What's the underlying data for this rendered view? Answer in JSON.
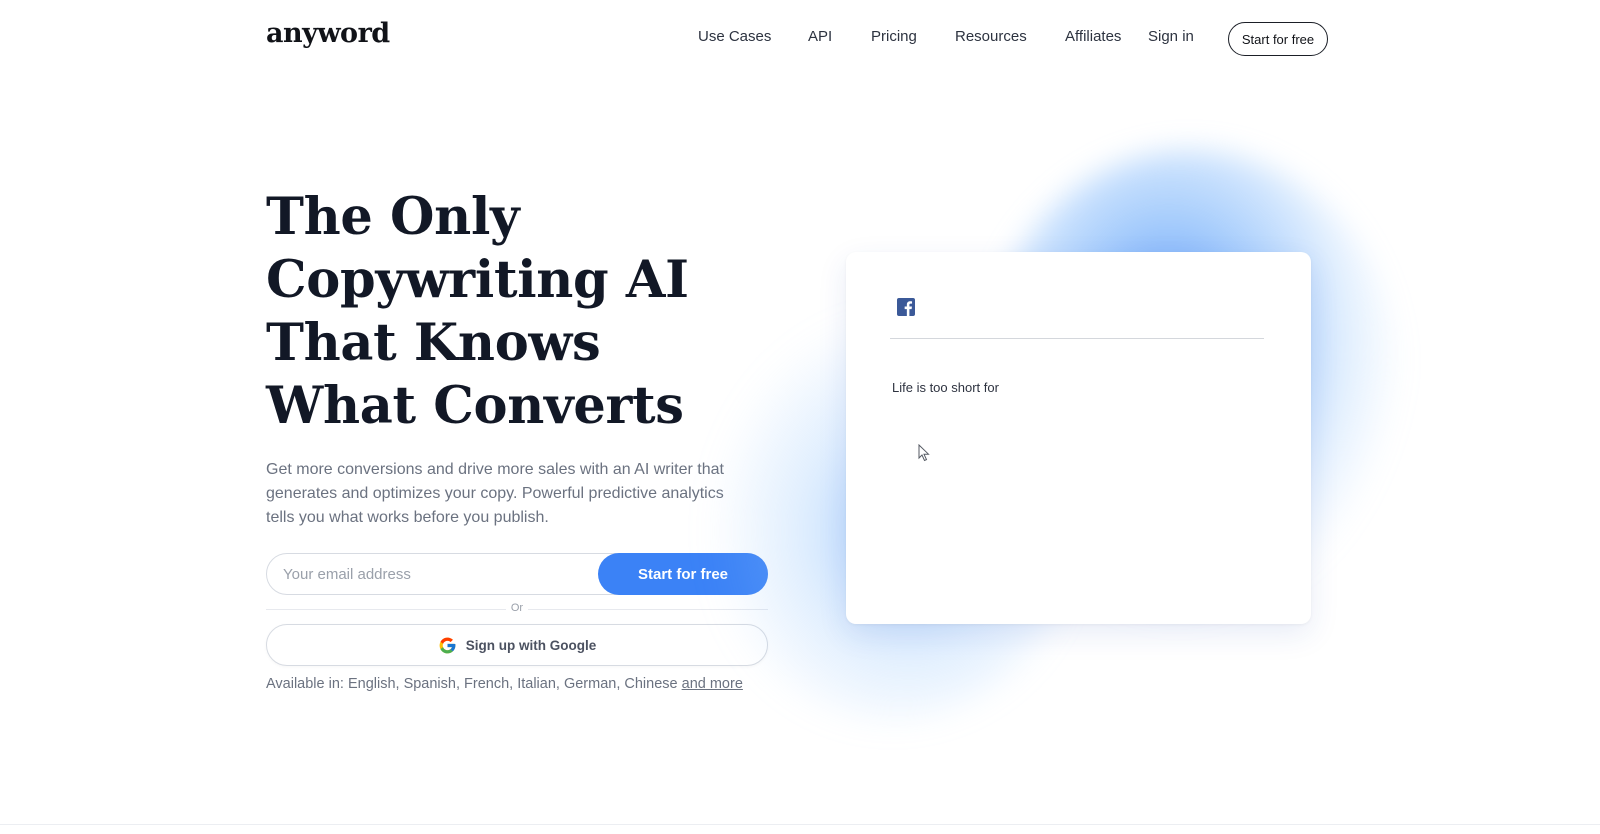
{
  "header": {
    "logo": "anyword",
    "nav": [
      "Use Cases",
      "API",
      "Pricing",
      "Resources",
      "Affiliates",
      "Sign in"
    ],
    "cta": "Start for free"
  },
  "hero": {
    "title": "The Only Copywriting AI That Knows What Converts",
    "subtitle": "Get more conversions and drive more sales with an AI writer that generates and optimizes your copy. Powerful predictive analytics tells you what works before you publish.",
    "email_placeholder": "Your email address",
    "submit_label": "Start for free",
    "or": "Or",
    "google_label": "Sign up with Google",
    "langs_prefix": "Available in: English, Spanish, French, Italian, German, Chinese",
    "langs_more": "and more"
  },
  "card": {
    "platform_icon": "facebook-icon",
    "typed_text": "Life is too short for",
    "brand_color": "#3b5998"
  },
  "colors": {
    "accent": "#3b82f6",
    "text_dark": "#121826",
    "text_muted": "#6b7280"
  }
}
